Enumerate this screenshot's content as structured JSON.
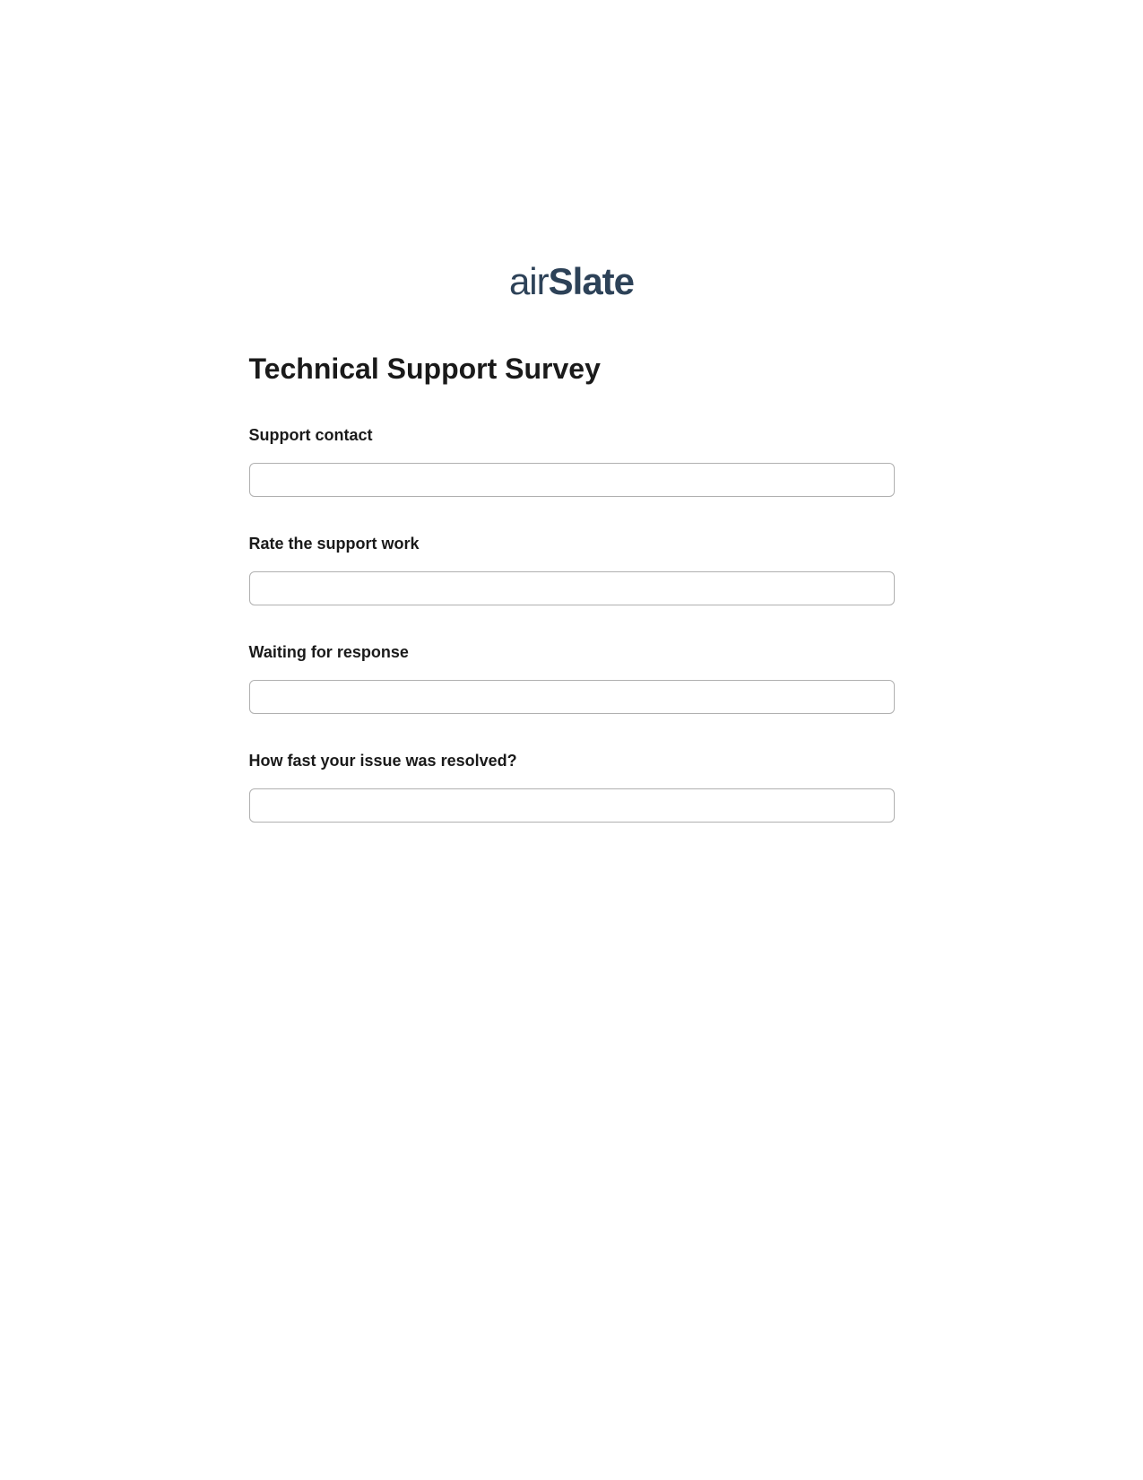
{
  "logo": {
    "text_prefix": "air",
    "text_suffix": "Slate"
  },
  "form": {
    "title": "Technical Support Survey",
    "fields": [
      {
        "label": "Support contact",
        "value": ""
      },
      {
        "label": "Rate the support work",
        "value": ""
      },
      {
        "label": "Waiting for response",
        "value": ""
      },
      {
        "label": "How fast your issue was resolved?",
        "value": ""
      }
    ]
  }
}
